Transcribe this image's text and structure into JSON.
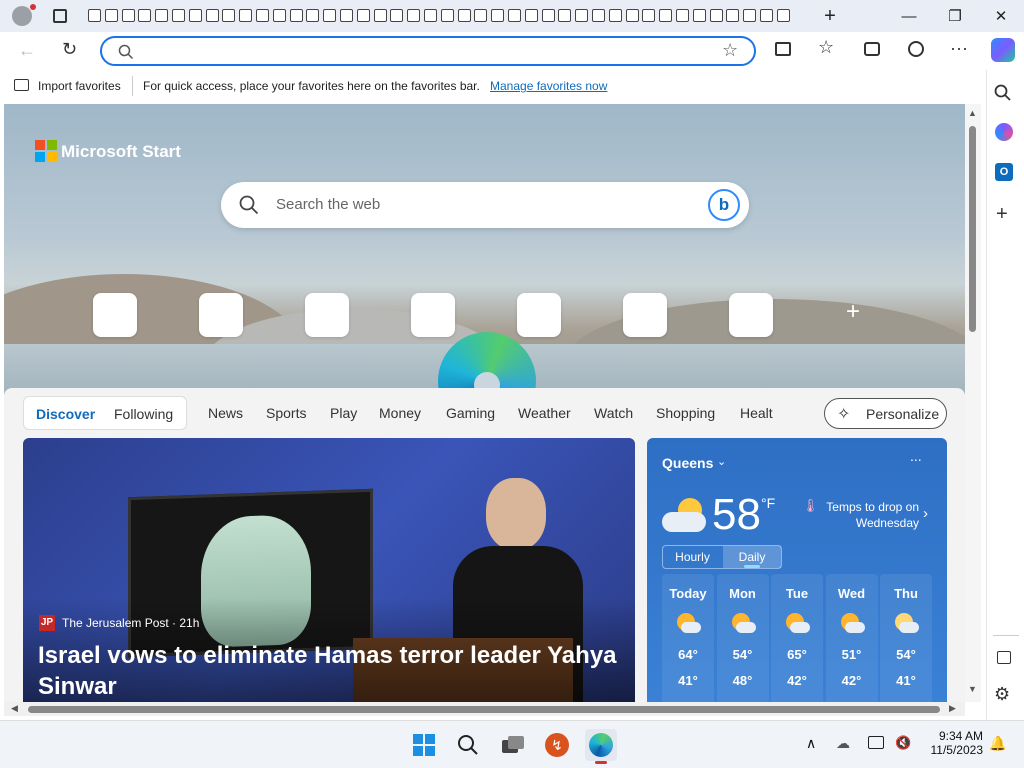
{
  "browser": {
    "address": {
      "value": "",
      "placeholder": ""
    },
    "favorites_bar": {
      "import_label": "Import favorites",
      "message": "For quick access, place your favorites here on the favorites bar.",
      "manage_link": "Manage favorites now"
    },
    "new_tab_symbol": "+",
    "window_controls": {
      "minimize": "—",
      "restore": "❐",
      "close": "✕"
    }
  },
  "page": {
    "brand": "Microsoft Start",
    "search_placeholder": "Search the web",
    "add_tile_symbol": "+",
    "feed_tabs": [
      "Discover",
      "Following"
    ],
    "nav_items": [
      "News",
      "Sports",
      "Play",
      "Money",
      "Gaming",
      "Weather",
      "Watch",
      "Shopping",
      "Healt"
    ],
    "personalize_label": "Personalize",
    "headline": {
      "source_badge": "JP",
      "source": "The Jerusalem Post · 21h",
      "title": "Israel vows to eliminate Hamas terror leader Yahya Sinwar"
    },
    "weather": {
      "location": "Queens",
      "temperature": "58",
      "unit": "°F",
      "alert": "Temps to drop on Wednesday",
      "tabs": [
        "Hourly",
        "Daily"
      ],
      "selected_tab": "Daily",
      "more": "...",
      "days": [
        {
          "day": "Today",
          "high": "64°",
          "low": "41°",
          "icon": "partly-sunny-icon"
        },
        {
          "day": "Mon",
          "high": "54°",
          "low": "48°",
          "icon": "partly-sunny-icon"
        },
        {
          "day": "Tue",
          "high": "65°",
          "low": "42°",
          "icon": "partly-sunny-icon"
        },
        {
          "day": "Wed",
          "high": "51°",
          "low": "42°",
          "icon": "partly-sunny-icon"
        },
        {
          "day": "Thu",
          "high": "54°",
          "low": "41°",
          "icon": "cloudy-icon"
        }
      ]
    }
  },
  "taskbar": {
    "time": "9:34 AM",
    "date": "11/5/2023"
  },
  "colors": {
    "accent": "#1a73e8",
    "link": "#0f6cbd",
    "weather_bg": "#3478cc",
    "taskbar": "#f0f3f8"
  }
}
